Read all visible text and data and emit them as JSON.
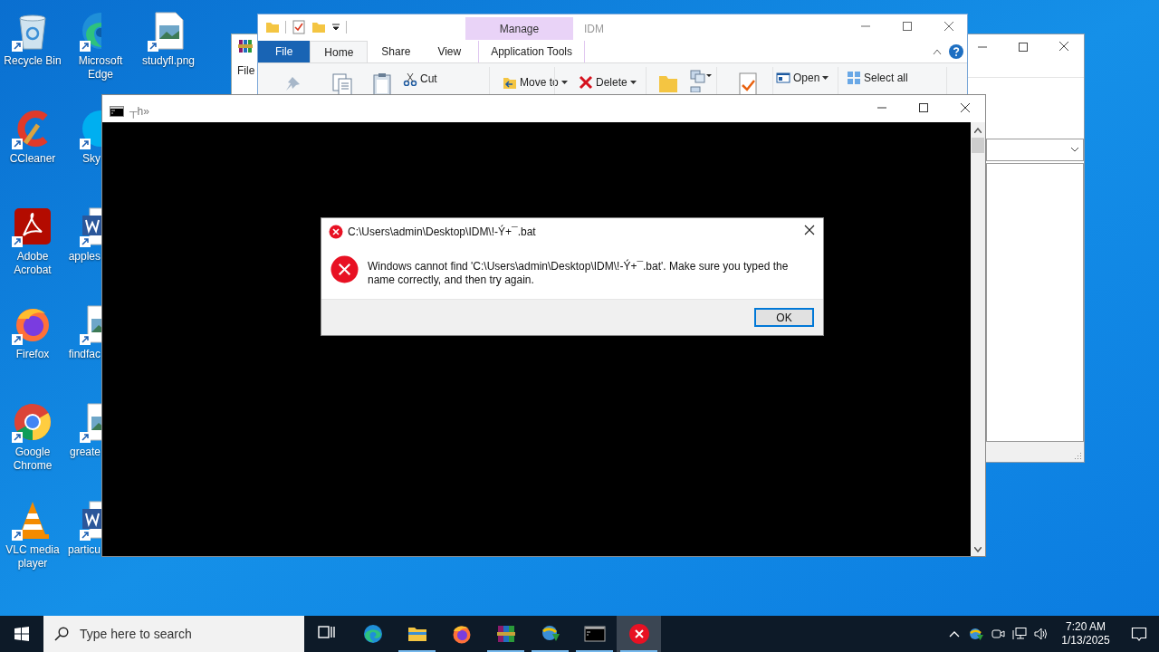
{
  "desktop_columns": [
    {
      "icons": [
        {
          "label": "Recycle Bin",
          "kind": "recycle"
        },
        {
          "label": "CCleaner",
          "kind": "ccleaner"
        },
        {
          "label": "Adobe Acrobat",
          "kind": "acrobat"
        },
        {
          "label": "Firefox",
          "kind": "firefox"
        },
        {
          "label": "Google Chrome",
          "kind": "chrome"
        },
        {
          "label": "VLC media player",
          "kind": "vlc"
        }
      ]
    },
    {
      "icons": [
        {
          "label": "Microsoft Edge",
          "kind": "edge"
        },
        {
          "label": "Sky",
          "kind": "skype"
        },
        {
          "label": "apples",
          "kind": "word"
        },
        {
          "label": "findfac",
          "kind": "image"
        },
        {
          "label": "greate",
          "kind": "image"
        },
        {
          "label": "particu",
          "kind": "word"
        }
      ]
    },
    {
      "icons": [
        {
          "label": "studyfl.png",
          "kind": "image"
        }
      ]
    }
  ],
  "left_window": {
    "menu": "File"
  },
  "explorer": {
    "title": "IDM",
    "context_tab": "Manage",
    "tabs": [
      {
        "label": "File",
        "kind": "file",
        "selected": false
      },
      {
        "label": "Home",
        "kind": "plain",
        "selected": true
      },
      {
        "label": "Share",
        "kind": "plain",
        "selected": false
      },
      {
        "label": "View",
        "kind": "plain",
        "selected": false
      },
      {
        "label": "Application Tools",
        "kind": "context",
        "selected": false
      }
    ],
    "ribbon": [
      {
        "kind": "pin"
      },
      {
        "kind": "copy"
      },
      {
        "kind": "paste"
      },
      {
        "kind": "cut",
        "label": "Cut",
        "dropdown": false
      },
      {
        "kind": "move",
        "label": "Move to",
        "dropdown": true
      },
      {
        "kind": "delete",
        "label": "Delete",
        "dropdown": true
      },
      {
        "kind": "folder"
      },
      {
        "kind": "copy-to"
      },
      {
        "kind": "properties"
      },
      {
        "kind": "open",
        "label": "Open",
        "dropdown": true
      },
      {
        "kind": "select",
        "label": "Select all",
        "dropdown": false
      }
    ]
  },
  "console": {
    "title": "┬h»"
  },
  "dialog": {
    "title": "C:\\Users\\admin\\Desktop\\IDM\\!-Ý+¯.bat",
    "message": "Windows cannot find 'C:\\Users\\admin\\Desktop\\IDM\\!-Ý+¯.bat'. Make sure you typed the name correctly, and then try again.",
    "button": "OK"
  },
  "taskbar": {
    "search_placeholder": "Type here to search",
    "apps": [
      {
        "kind": "taskview",
        "running": false,
        "selected": false
      },
      {
        "kind": "edge",
        "running": false,
        "selected": false
      },
      {
        "kind": "explorer",
        "running": true,
        "selected": false
      },
      {
        "kind": "firefox",
        "running": false,
        "selected": false
      },
      {
        "kind": "winrar",
        "running": true,
        "selected": false
      },
      {
        "kind": "idm",
        "running": true,
        "selected": false
      },
      {
        "kind": "cmd",
        "running": true,
        "selected": false
      },
      {
        "kind": "error",
        "running": true,
        "selected": true
      }
    ],
    "time": "7:20 AM",
    "date": "1/13/2025"
  }
}
